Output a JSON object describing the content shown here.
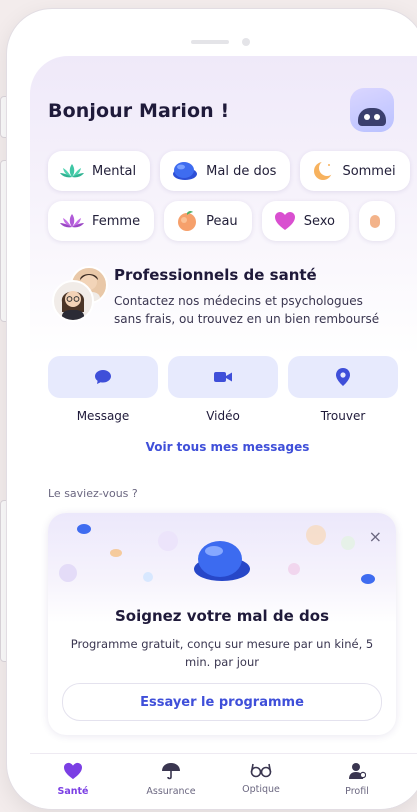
{
  "greeting": "Bonjour Marion !",
  "chips_row1": [
    {
      "label": "Mental",
      "icon": "lotus-icon"
    },
    {
      "label": "Mal de dos",
      "icon": "turtle-shell-icon"
    },
    {
      "label": "Sommei",
      "icon": "moon-icon"
    }
  ],
  "chips_row2": [
    {
      "label": "Femme",
      "icon": "flower-icon"
    },
    {
      "label": "Peau",
      "icon": "peach-icon"
    },
    {
      "label": "Sexo",
      "icon": "heart-icon"
    }
  ],
  "pros": {
    "title": "Professionnels de santé",
    "subtitle": "Contactez nos médecins et psychologues sans frais, ou trouvez en un bien remboursé"
  },
  "actions": [
    {
      "label": "Message",
      "icon": "chat-icon"
    },
    {
      "label": "Vidéo",
      "icon": "video-camera-icon"
    },
    {
      "label": "Trouver",
      "icon": "location-pin-icon"
    }
  ],
  "see_all_messages": "Voir tous mes messages",
  "did_you_know": "Le saviez-vous ?",
  "tip": {
    "title": "Soignez votre mal de dos",
    "description": "Programme gratuit, conçu sur mesure par un kiné, 5 min. par jour",
    "button": "Essayer le programme",
    "close": "×"
  },
  "tabs": [
    {
      "label": "Santé",
      "icon": "heart-tab-icon",
      "active": true
    },
    {
      "label": "Assurance",
      "icon": "umbrella-icon",
      "active": false
    },
    {
      "label": "Optique",
      "icon": "glasses-icon",
      "active": false
    },
    {
      "label": "Profil",
      "icon": "profile-icon",
      "active": false
    }
  ],
  "colors": {
    "accent": "#3f4fd9",
    "tab_active": "#7b3fe4",
    "action_bg": "#e7eafd"
  }
}
